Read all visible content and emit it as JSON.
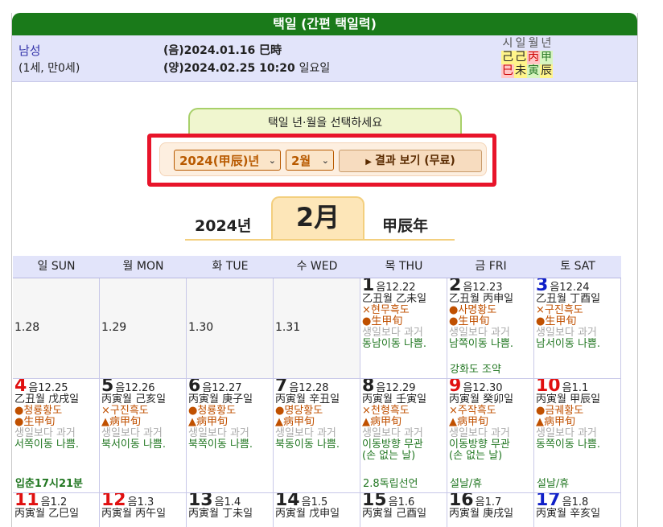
{
  "title": "택일 (간편 택일력)",
  "person": {
    "gender": "남성",
    "age": "(1세, 만0세)",
    "lunar": "(음)2024.01.16 巳時",
    "solar": "(양)2024.02.25 10:20",
    "weekday": "일요일"
  },
  "pillars": {
    "headers": [
      "시",
      "일",
      "월",
      "년"
    ],
    "stems": [
      "己",
      "己",
      "丙",
      "甲"
    ],
    "branches": [
      "巳",
      "未",
      "寅",
      "辰"
    ]
  },
  "selector": {
    "prompt": "택일 년·월을 선택하세요",
    "year": "2024(甲辰)년",
    "month": "2월",
    "button": "결과 보기 (무료)"
  },
  "heading": {
    "year": "2024년",
    "month": "2月",
    "ganji": "甲辰年"
  },
  "dow": [
    "일 SUN",
    "월 MON",
    "화 TUE",
    "수 WED",
    "목 THU",
    "금 FRI",
    "토 SAT"
  ],
  "prev_days": [
    "1.28",
    "1.29",
    "1.30",
    "1.31"
  ],
  "days": {
    "d1": {
      "num": "1",
      "lunar": "음12.22",
      "ganji": "乙丑월 乙未일",
      "l1": "×현무흑도",
      "l2": "●生甲旬",
      "l3": "생일보다 과거",
      "l4": "동남이동 나쁨."
    },
    "d2": {
      "num": "2",
      "lunar": "음12.23",
      "ganji": "乙丑월 丙申일",
      "l1": "●사명황도",
      "l2": "●生甲旬",
      "l3": "생일보다 과거",
      "l4": "남쪽이동 나쁨.",
      "note": "강화도 조약"
    },
    "d3": {
      "num": "3",
      "lunar": "음12.24",
      "ganji": "乙丑월 丁酉일",
      "l1": "×구진흑도",
      "l2": "●生甲旬",
      "l3": "생일보다 과거",
      "l4": "남서이동 나쁨."
    },
    "d4": {
      "num": "4",
      "lunar": "음12.25",
      "ganji": "乙丑월 戊戌일",
      "l1": "●청룡황도",
      "l2": "●生甲旬",
      "l3": "생일보다 과거",
      "l4": "서쪽이동 나쁨.",
      "note": "입춘17시21분"
    },
    "d5": {
      "num": "5",
      "lunar": "음12.26",
      "ganji": "丙寅월 己亥일",
      "l1": "×구진흑도",
      "l2": "▲病甲旬",
      "l3": "생일보다 과거",
      "l4": "북서이동 나쁨."
    },
    "d6": {
      "num": "6",
      "lunar": "음12.27",
      "ganji": "丙寅월 庚子일",
      "l1": "●청룡황도",
      "l2": "▲病甲旬",
      "l3": "생일보다 과거",
      "l4": "북쪽이동 나쁨."
    },
    "d7": {
      "num": "7",
      "lunar": "음12.28",
      "ganji": "丙寅월 辛丑일",
      "l1": "●명당황도",
      "l2": "▲病甲旬",
      "l3": "생일보다 과거",
      "l4": "북동이동 나쁨."
    },
    "d8": {
      "num": "8",
      "lunar": "음12.29",
      "ganji": "丙寅월 壬寅일",
      "l1": "×천형흑도",
      "l2": "▲病甲旬",
      "l3": "생일보다 과거",
      "l4": "이동방향 무관",
      "l5": "(손 없는 날)",
      "note": "2.8독립선언"
    },
    "d9": {
      "num": "9",
      "lunar": "음12.30",
      "ganji": "丙寅월 癸卯일",
      "l1": "×주작흑도",
      "l2": "▲病甲旬",
      "l3": "생일보다 과거",
      "l4": "이동방향 무관",
      "l5": "(손 없는 날)",
      "note": "설날/휴"
    },
    "d10": {
      "num": "10",
      "lunar": "음1.1",
      "ganji": "丙寅월 甲辰일",
      "l1": "●금궤황도",
      "l2": "▲病甲旬",
      "l3": "생일보다 과거",
      "l4": "동쪽이동 나쁨.",
      "note": "설날/휴"
    },
    "d11": {
      "num": "11",
      "lunar": "음1.2",
      "ganji": "丙寅월 乙巳일"
    },
    "d12": {
      "num": "12",
      "lunar": "음1.3",
      "ganji": "丙寅월 丙午일"
    },
    "d13": {
      "num": "13",
      "lunar": "음1.4",
      "ganji": "丙寅월 丁未일"
    },
    "d14": {
      "num": "14",
      "lunar": "음1.5",
      "ganji": "丙寅월 戊申일"
    },
    "d15": {
      "num": "15",
      "lunar": "음1.6",
      "ganji": "丙寅월 己酉일"
    },
    "d16": {
      "num": "16",
      "lunar": "음1.7",
      "ganji": "丙寅월 庚戌일"
    },
    "d17": {
      "num": "17",
      "lunar": "음1.8",
      "ganji": "丙寅월 辛亥일"
    }
  },
  "colors": {
    "title_bar": "#1a7a1a",
    "highlight_border": "#e8142a",
    "sunday": "#e01010",
    "saturday": "#1020c8"
  }
}
